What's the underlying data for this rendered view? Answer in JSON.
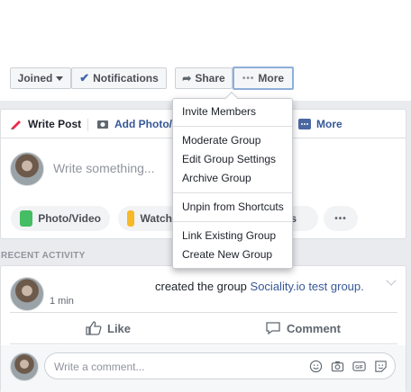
{
  "header_buttons": {
    "joined_label": "Joined",
    "notifications_label": "Notifications",
    "share_label": "Share",
    "more_label": "More"
  },
  "composer": {
    "tabs": {
      "write_post": "Write Post",
      "add_photo": "Add Photo/V",
      "more": "More"
    },
    "placeholder": "Write something...",
    "actions": {
      "photo_video": "Photo/Video",
      "watch": "Watch",
      "feeling_partial": "ds"
    }
  },
  "more_menu": {
    "items": [
      "Invite Members",
      "Moderate Group",
      "Edit Group Settings",
      "Archive Group",
      "Unpin from Shortcuts",
      "Link Existing Group",
      "Create New Group"
    ]
  },
  "recent_activity": {
    "label": "RECENT ACTIVITY",
    "post": {
      "action_text": "created the group ",
      "group_name": "Sociality.io test group.",
      "time": "1 min",
      "like_label": "Like",
      "comment_label": "Comment",
      "comment_placeholder": "Write a comment..."
    }
  },
  "colors": {
    "accent": "#4267b2",
    "link": "#365899",
    "background": "#e9ebee"
  }
}
